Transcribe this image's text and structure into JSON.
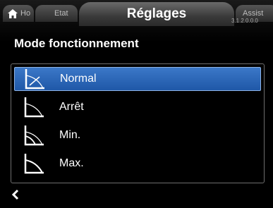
{
  "tabs": {
    "home_label": "Ho",
    "etat_label": "Etat",
    "active_label": "Réglages",
    "assist_label": "Assist"
  },
  "version": "3.1.2.0.0.0",
  "page_title": "Mode fonctionnement",
  "options": [
    {
      "label": "Normal",
      "icon": "normal-curve-icon",
      "selected": true
    },
    {
      "label": "Arrêt",
      "icon": "stop-curve-icon",
      "selected": false
    },
    {
      "label": "Min.",
      "icon": "min-curve-icon",
      "selected": false
    },
    {
      "label": "Max.",
      "icon": "max-curve-icon",
      "selected": false
    }
  ],
  "colors": {
    "selection": "#2a63b3",
    "background": "#000000",
    "text": "#ffffff"
  }
}
